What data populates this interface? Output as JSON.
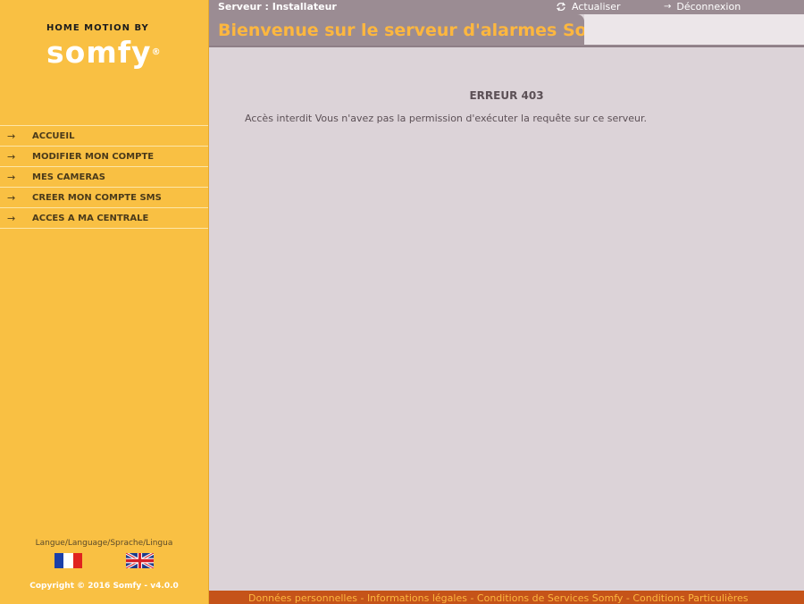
{
  "brand": {
    "tagline": "HOME MOTION BY",
    "logo": "somfy",
    "logo_mark": "®"
  },
  "header": {
    "server_label": "Serveur : Installateur",
    "refresh": "Actualiser",
    "logout": "Déconnexion",
    "welcome_title": "Bienvenue sur le serveur d'alarmes Somfy"
  },
  "nav": {
    "items": [
      {
        "label": "ACCUEIL"
      },
      {
        "label": "MODIFIER MON COMPTE"
      },
      {
        "label": "MES CAMERAS"
      },
      {
        "label": "CREER MON COMPTE SMS"
      },
      {
        "label": "ACCES A MA CENTRALE"
      }
    ]
  },
  "language": {
    "label": "Langue/Language/Sprache/Lingua"
  },
  "copyright": "Copyright © 2016 Somfy - v4.0.0",
  "error": {
    "title": "ERREUR 403",
    "message": "Accès interdit Vous n'avez pas la permission d'exécuter la requête sur ce serveur."
  },
  "footer": {
    "links": [
      "Données personnelles",
      "Informations légales",
      "Conditions de Services Somfy",
      "Conditions Particulières"
    ],
    "separator": " - "
  },
  "colors": {
    "sidebar": "#f9c043",
    "accent": "#fdb73f",
    "header": "#9b8c93",
    "main_bg": "#dcd3d8",
    "footer": "#c55319"
  }
}
